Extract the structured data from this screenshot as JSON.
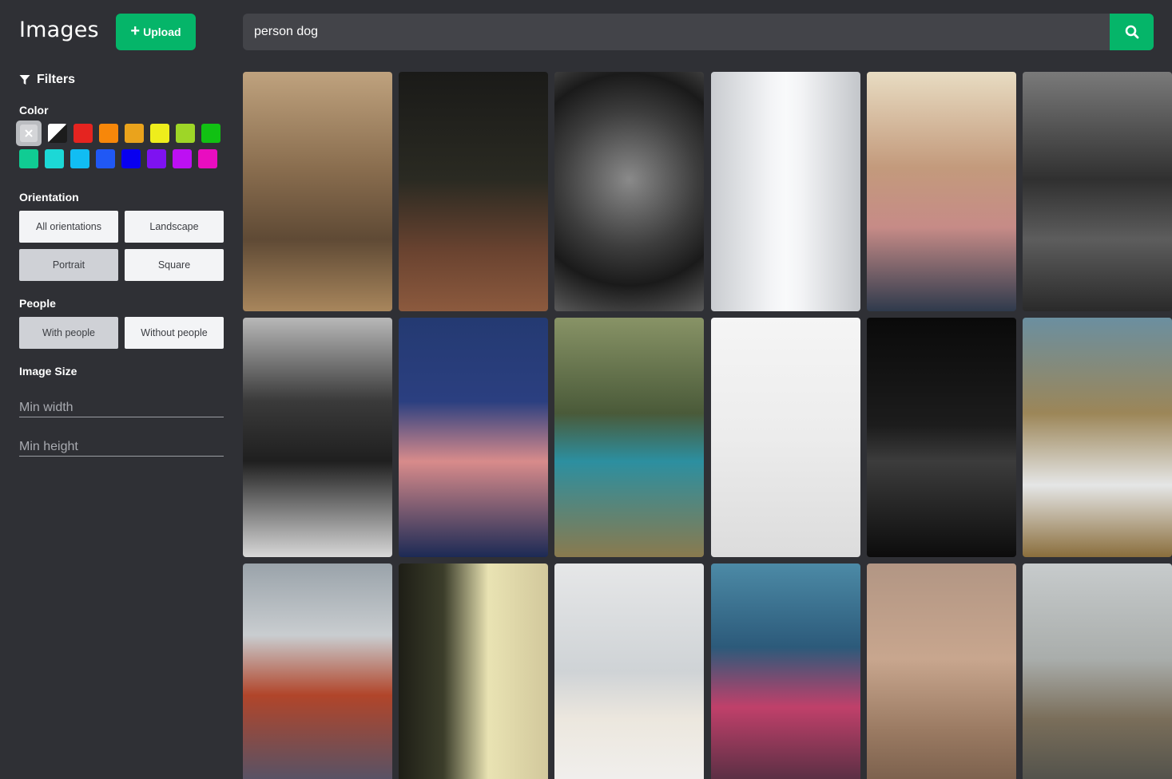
{
  "app": {
    "title": "Images"
  },
  "header": {
    "upload_label": "Upload"
  },
  "search": {
    "value": "person dog"
  },
  "filters": {
    "title": "Filters",
    "color": {
      "label": "Color",
      "swatches": [
        "any",
        "black-white",
        "#e52420",
        "#f7870a",
        "#eaa31c",
        "#eeed1c",
        "#9ed627",
        "#11c113",
        "#10cc93",
        "#1cd8d6",
        "#11bdf3",
        "#2058f5",
        "#0800f0",
        "#7e12f1",
        "#bd10f3",
        "#e90dc0"
      ]
    },
    "orientation": {
      "label": "Orientation",
      "options": [
        "All orientations",
        "Landscape",
        "Portrait",
        "Square"
      ],
      "selected": "Portrait"
    },
    "people": {
      "label": "People",
      "options": [
        "With people",
        "Without people"
      ],
      "selected": "With people"
    },
    "image_size": {
      "label": "Image Size",
      "min_width_placeholder": "Min width",
      "min_height_placeholder": "Min height"
    }
  },
  "results": [
    {
      "desc": "woman-with-husky-in-desert",
      "bg": "linear-gradient(180deg,#bfa27e 0%,#8a6e4f 40%,#5f4a35 70%,#a8865c 100%)"
    },
    {
      "desc": "person-walking-dog-city-night",
      "bg": "linear-gradient(180deg,#1a1a18 0%,#2a2a22 45%,#6a4330 75%,#8c5a3e 100%)"
    },
    {
      "desc": "bw-portrait-curly-hair",
      "bg": "radial-gradient(circle at 50% 45%,#8a8a8a 0%,#3d3d3d 45%,#1a1a1a 70%,#5a5a5a 100%)"
    },
    {
      "desc": "white-ribbed-architecture",
      "bg": "linear-gradient(90deg,#c9ccd0 0%,#f3f4f6 40%,#f9fafb 50%,#f3f4f6 60%,#c3c6ca 100%)"
    },
    {
      "desc": "two-women-hugging",
      "bg": "linear-gradient(180deg,#e8dcc2 0%,#c39a7c 40%,#c68b87 65%,#2f3a4c 100%)"
    },
    {
      "desc": "bw-woman-city-buildings",
      "bg": "linear-gradient(180deg,#7a7a7a 0%,#303030 45%,#5d5d5d 70%,#2a2a2a 100%)"
    },
    {
      "desc": "bw-man-sitting-on-chair",
      "bg": "linear-gradient(180deg,#b8b8b8 0%,#3a3a3a 35%,#1f1f1f 60%,#d8d8d8 100%)"
    },
    {
      "desc": "woman-in-cinema-with-popcorn",
      "bg": "linear-gradient(180deg,#243a72 0%,#2b3f80 35%,#d88b8b 60%,#1c2a55 100%)"
    },
    {
      "desc": "woman-tie-dye-shirt-field",
      "bg": "linear-gradient(180deg,#889366 0%,#4a5a39 40%,#2c8fa0 60%,#8a7a4e 100%)"
    },
    {
      "desc": "laptop-coffee-phone-flatlay",
      "bg": "linear-gradient(180deg,#f5f5f5 0%,#ececec 50%,#dcdcdc 100%)"
    },
    {
      "desc": "dark-silhouette-doorway",
      "bg": "linear-gradient(180deg,#0a0a0a 0%,#1c1c1c 45%,#3c3c3c 60%,#0c0c0c 100%)"
    },
    {
      "desc": "woman-white-shirt-wheat-field",
      "bg": "linear-gradient(180deg,#6b8fa0 0%,#9c8658 40%,#e5e6e6 70%,#8a6e3c 100%)"
    },
    {
      "desc": "woman-red-jacket-kick",
      "bg": "linear-gradient(180deg,#9aa3aa 0%,#c9cdd0 30%,#b1452a 55%,#3f5676 100%)"
    },
    {
      "desc": "woman-beige-coat-wall",
      "bg": "linear-gradient(90deg,#1e1e16 0%,#3b3d2a 30%,#e9e3b3 60%,#d2c89c 100%)"
    },
    {
      "desc": "woman-sitting-window-bench",
      "bg": "linear-gradient(180deg,#e6e7e8 0%,#cfd3d6 45%,#ece7de 65%,#f2f2f2 100%)"
    },
    {
      "desc": "woman-red-laser-portrait",
      "bg": "linear-gradient(180deg,#4c8aa6 0%,#2c5a7a 35%,#c0406a 60%,#3a2a38 100%)"
    },
    {
      "desc": "surfer-on-beach-sunset",
      "bg": "linear-gradient(180deg,#b29684 0%,#c8a68e 40%,#9a7a62 70%,#6e5644 100%)"
    },
    {
      "desc": "woman-beanie-field",
      "bg": "linear-gradient(180deg,#c7cbcc 0%,#a9adab 40%,#7a6e5a 65%,#444846 100%)"
    }
  ]
}
